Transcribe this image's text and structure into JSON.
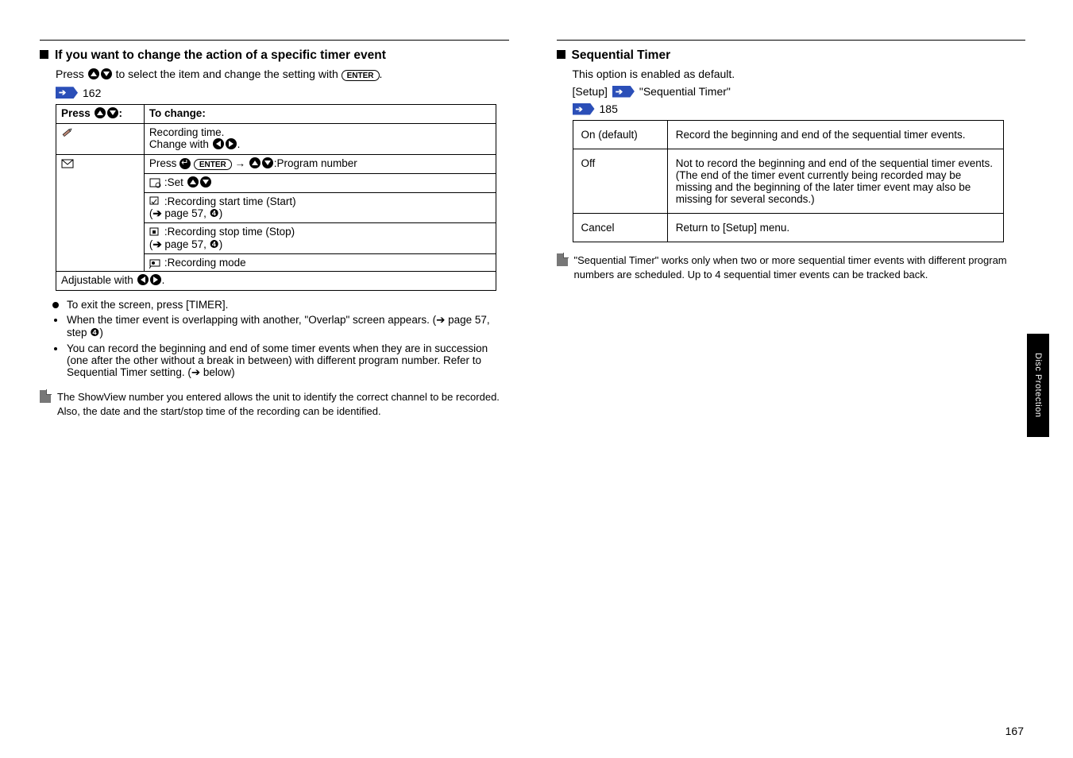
{
  "left": {
    "section_title": "If you want to change the action of a specific timer event",
    "lead_a": "Press ",
    "lead_b": " to select the item and change the setting with ",
    "lead_c": ".",
    "ref_link": "162",
    "table": {
      "header_col1_a": "Press ",
      "header_col1_b": ":",
      "header_col2": "To change:",
      "row_pencil_a": "Recording time.",
      "row_pencil_b": "Change with ",
      "row_pencil_c": ".",
      "row_env_enter_a": "Press ",
      "row_env_enter_b": ":Program number ",
      "row_env_set": ":Set ",
      "row_env_start_a": ":Recording start time (Start)",
      "row_env_start_b": "(",
      "row_env_start_c": " page 57, ❹)",
      "row_env_stop_a": ":Recording stop time (Stop)",
      "row_env_stop_b": "(",
      "row_env_stop_c": " page 57, ❹)",
      "row_env_mode": ":Recording mode",
      "footer_a": "Adjustable with ",
      "footer_b": "."
    },
    "bullets": {
      "b1": "To exit the screen, press [TIMER].",
      "b2": "When the timer event is overlapping with another, \"Overlap\" screen appears. (➔ page 57, step ❹)",
      "b3": "You can record the beginning and end of some timer events when they are in succession (one after the other without a break in between) with different program number. Refer to Sequential Timer setting. (➔ below)"
    },
    "note": "The ShowView number you entered allows the unit to identify the correct channel to be recorded. Also, the date and the start/stop time of the recording can be identified."
  },
  "right": {
    "section_title": "Sequential Timer",
    "body_a": "This option is enabled as default.",
    "body_b": "[Setup] ",
    "body_c": " \"Sequential Timer\"",
    "ref_link": "185",
    "table": {
      "r1c1": "On (default)",
      "r1c2": "Record the beginning and end of the sequential timer events.",
      "r2c1": "Off",
      "r2c2": "Not to record the beginning and end of the sequential timer events. (The end of the timer event currently being recorded may be missing and the beginning of the later timer event may also be missing for several seconds.)",
      "r3c1": "Cancel",
      "r3c2": "Return to [Setup] menu."
    },
    "note": "\"Sequential Timer\" works only when two or more sequential timer events with different program numbers are scheduled. Up to 4 sequential timer events can be tracked back."
  },
  "footer": {
    "page_number": "167",
    "side_tab": "Disc Protection",
    "doc_ref": ""
  }
}
